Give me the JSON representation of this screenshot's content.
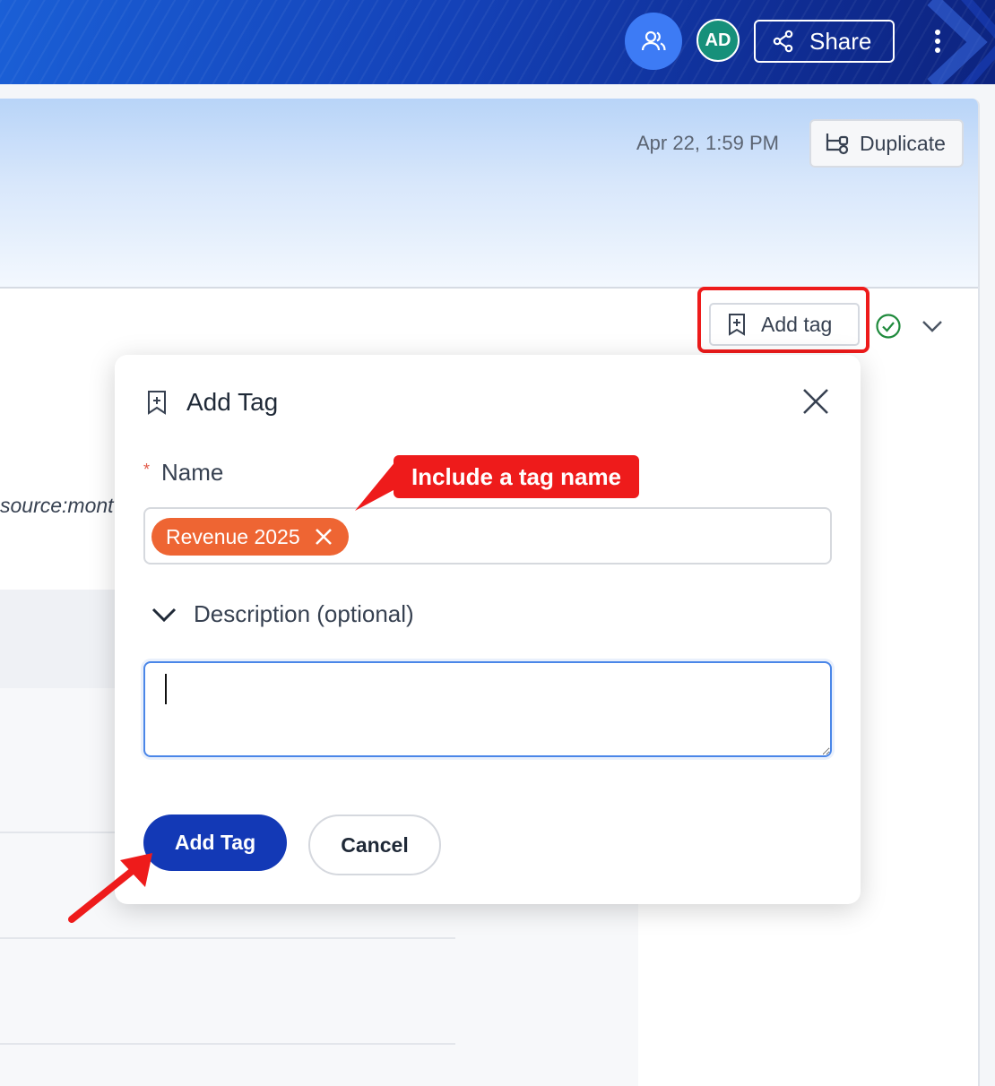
{
  "topbar": {
    "avatar_initials": "AD",
    "share_label": "Share",
    "icons": [
      "people-icon",
      "share-icon",
      "more-vertical-icon"
    ]
  },
  "header": {
    "timestamp": "Apr 22, 1:59 PM",
    "duplicate_label": "Duplicate"
  },
  "toolbar": {
    "add_tag_label": "Add tag"
  },
  "background": {
    "side_text": "source:mont"
  },
  "modal": {
    "title": "Add Tag",
    "name_label": "Name",
    "required_marker": "*",
    "tag_chip": "Revenue 2025",
    "description_toggle": "Description (optional)",
    "description_value": "",
    "submit_label": "Add Tag",
    "cancel_label": "Cancel"
  },
  "annotations": {
    "callout_text": "Include a tag name"
  },
  "colors": {
    "primary": "#1339b6",
    "chip": "#ee6533",
    "annotation": "#ee1b1b",
    "avatar": "#16907a",
    "success": "#1f8a3c"
  }
}
